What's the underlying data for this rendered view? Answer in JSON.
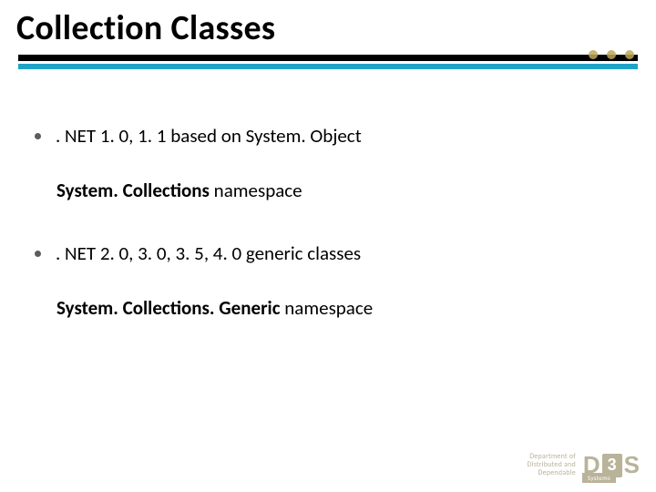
{
  "title": "Collection Classes",
  "bullets": [
    {
      "text": ". NET 1. 0, 1. 1 based on System. Object"
    },
    {
      "text": ". NET 2. 0, 3. 0, 3. 5, 4. 0 generic classes"
    }
  ],
  "subs": [
    {
      "bold": "System. Collections",
      "rest": " namespace"
    },
    {
      "bold": "System. Collections. Generic",
      "rest": " namespace"
    }
  ],
  "footer": {
    "dept_line1": "Department of",
    "dept_line2": "Distributed and",
    "dept_line3": "Dependable",
    "systems": "Systems",
    "logo_d": "D",
    "logo_3": "3",
    "logo_s": "S"
  }
}
